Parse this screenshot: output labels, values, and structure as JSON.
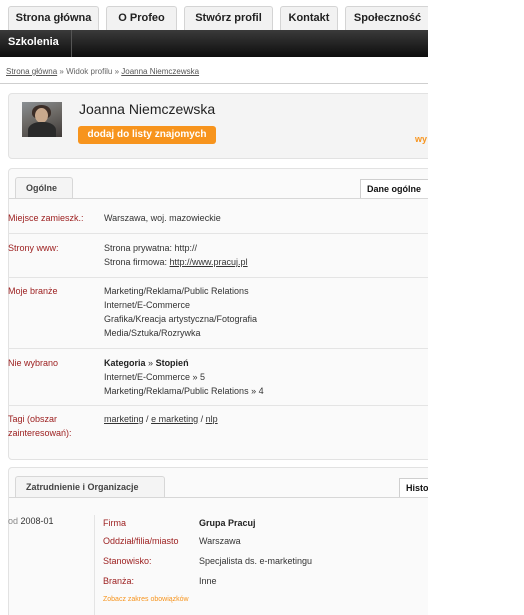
{
  "nav": {
    "tabs": [
      {
        "label": "Strona główna"
      },
      {
        "label": "O Profeo"
      },
      {
        "label": "Stwórz profil"
      },
      {
        "label": "Kontakt"
      },
      {
        "label": "Społeczność"
      }
    ],
    "sub_item": "Szkolenia"
  },
  "breadcrumb": {
    "home": "Strona główna",
    "sep1": "»",
    "current": "Widok profilu",
    "sep2": "»",
    "person": "Joanna Niemczewska"
  },
  "profile": {
    "name": "Joanna Niemczewska",
    "add_friend_label": "dodaj do listy znajomych",
    "cut_action": "wy"
  },
  "general": {
    "tab_label": "Ogólne",
    "right_tab_label": "Dane ogólne",
    "rows": {
      "location": {
        "label": "Miejsce zamieszk.:",
        "value": "Warszawa, woj. mazowieckie"
      },
      "websites": {
        "label": "Strony www:",
        "private_prefix": "Strona prywatna: http://",
        "company_prefix": "Strona firmowa: ",
        "company_url": "http://www.pracuj.pl"
      },
      "industries": {
        "label": "Moje branże",
        "items": [
          "Marketing/Reklama/Public Relations",
          "Internet/E-Commerce",
          "Grafika/Kreacja artystyczna/Fotografia",
          "Media/Sztuka/Rozrywka"
        ]
      },
      "unselected": {
        "label": "Nie wybrano",
        "header_category": "Kategoria",
        "header_sep": "»",
        "header_level": "Stopień",
        "items": [
          "Internet/E-Commerce » 5",
          "Marketing/Reklama/Public Relations » 4"
        ]
      },
      "tags": {
        "label_line1": "Tagi (obszar",
        "label_line2": "zainteresowań):",
        "items": [
          "marketing",
          "e marketing",
          "nlp"
        ],
        "sep": "/"
      }
    }
  },
  "employment": {
    "tab_label": "Zatrudnienie i Organizacje",
    "right_tab_label": "Histo",
    "date_prefix": "od",
    "date": "2008-01",
    "fields": [
      {
        "key": "Firma",
        "value": "Grupa Pracuj",
        "bold": true
      },
      {
        "key": "Oddział/filia/miasto",
        "value": "Warszawa",
        "bold": false
      },
      {
        "key": "Stanowisko:",
        "value": "Specjalista ds. e-marketingu",
        "bold": false
      },
      {
        "key": "Branża:",
        "value": "Inne",
        "bold": false
      }
    ],
    "more_link": "Zobacz zakres obowiązków"
  },
  "colors": {
    "accent": "#f7941d",
    "label_red": "#9b1c1c",
    "nav_dark": "#111111"
  }
}
